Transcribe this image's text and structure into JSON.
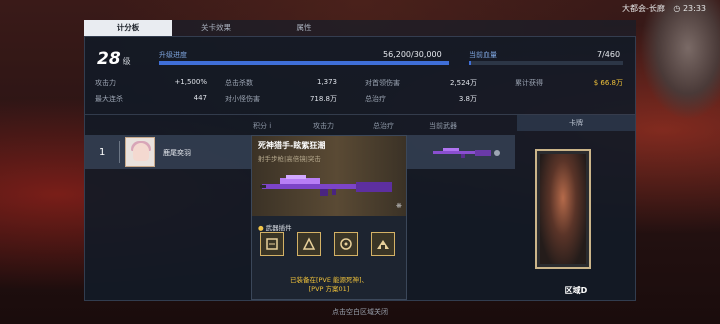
{
  "header": {
    "location": "大都会-长廊",
    "clock_icon": "clock-icon",
    "time": "23:33"
  },
  "tabs": [
    {
      "label": "计分板",
      "active": true
    },
    {
      "label": "关卡效果",
      "active": false
    },
    {
      "label": "属性",
      "active": false
    }
  ],
  "summary": {
    "level": "28",
    "level_unit": "级",
    "upgrade_label": "升级进度",
    "upgrade_value": "56,200/30,000",
    "upgrade_progress": 1.0,
    "current_label": "当前血量",
    "current_value": "7/460",
    "current_progress": 0.015
  },
  "stats": [
    {
      "label": "攻击力",
      "value": "+1,500%"
    },
    {
      "label": "总击杀数",
      "value": "1,373"
    },
    {
      "label": "对首领伤害",
      "value": "2,524万"
    },
    {
      "label": "累计获得",
      "value": "66.8万",
      "icon": "dollar-icon"
    },
    {
      "label": "最大连杀",
      "value": "447"
    },
    {
      "label": "对小怪伤害",
      "value": "718.8万"
    },
    {
      "label": "总治疗",
      "value": "3.8万"
    }
  ],
  "table": {
    "headers": [
      "积分",
      "攻击力",
      "总治疗",
      "当前武器"
    ],
    "info_icon": "i",
    "card_header": "卡牌",
    "row": {
      "rank": "1",
      "player": "鹿尾奕羽"
    }
  },
  "weapon_popup": {
    "name": "死神猎手-眩紫狂潮",
    "type": "射手步枪|高倍镜|突击",
    "attachments_title": "武器插件",
    "attachments": [
      "scope-attachment-icon",
      "muzzle-attachment-icon",
      "magazine-attachment-icon",
      "stock-attachment-icon"
    ],
    "equip_line1": "已装备在[PVE 能源死神]、",
    "equip_line2": "[PVP 方案01]"
  },
  "card": {
    "name": "区域D"
  },
  "footer": {
    "hint": "点击空白区域关闭"
  },
  "colors": {
    "accent_blue": "#3f6fd8",
    "gold": "#f0c23a"
  }
}
